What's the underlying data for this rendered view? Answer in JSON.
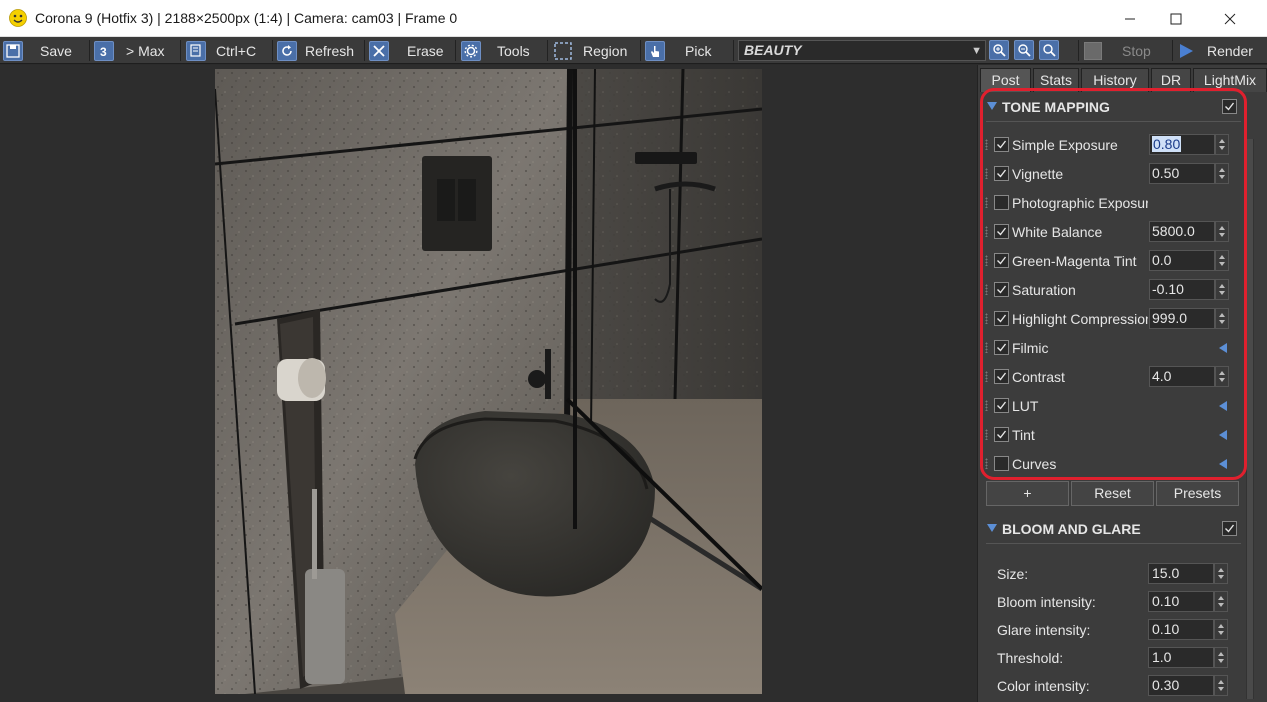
{
  "window": {
    "title": "Corona 9 (Hotfix 3) | 2188×2500px (1:4) | Camera: cam03 | Frame 0",
    "app_icon": "smiley-icon",
    "controls": [
      "minimize-icon",
      "maximize-icon",
      "close-icon"
    ]
  },
  "toolbar": {
    "save_label": "Save",
    "max_label": "> Max",
    "copy_label": "Ctrl+C",
    "refresh_label": "Refresh",
    "erase_label": "Erase",
    "tools_label": "Tools",
    "region_label": "Region",
    "pick_label": "Pick",
    "pass_selected": "BEAUTY",
    "stop_label": "Stop",
    "render_label": "Render"
  },
  "render": {
    "scene": "bathroom with wall-hung black toilet, grey stone wall, glass shower partition, toilet paper holder, brush holder"
  },
  "panel": {
    "tabs": [
      {
        "label": "Post",
        "active": true
      },
      {
        "label": "Stats",
        "active": false
      },
      {
        "label": "History",
        "active": false
      },
      {
        "label": "DR",
        "active": false
      },
      {
        "label": "LightMix",
        "active": false
      }
    ],
    "tone_mapping": {
      "title": "TONE MAPPING",
      "enabled": true,
      "rows": [
        {
          "label": "Simple Exposure",
          "checked": true,
          "value": "0.80",
          "kind": "spin",
          "selected": true
        },
        {
          "label": "Vignette",
          "checked": true,
          "value": "0.50",
          "kind": "spin"
        },
        {
          "label": "Photographic Exposure",
          "checked": false,
          "value": "",
          "kind": "none"
        },
        {
          "label": "White Balance",
          "checked": true,
          "value": "5800.0",
          "kind": "spin"
        },
        {
          "label": "Green-Magenta Tint",
          "checked": true,
          "value": "0.0",
          "kind": "spin"
        },
        {
          "label": "Saturation",
          "checked": true,
          "value": "-0.10",
          "kind": "spin"
        },
        {
          "label": "Highlight Compression",
          "checked": true,
          "value": "999.0",
          "kind": "spin"
        },
        {
          "label": "Filmic",
          "checked": true,
          "value": "",
          "kind": "expand"
        },
        {
          "label": "Contrast",
          "checked": true,
          "value": "4.0",
          "kind": "spin"
        },
        {
          "label": "LUT",
          "checked": true,
          "value": "",
          "kind": "expand"
        },
        {
          "label": "Tint",
          "checked": true,
          "value": "",
          "kind": "expand"
        },
        {
          "label": "Curves",
          "checked": false,
          "value": "",
          "kind": "expand"
        }
      ],
      "buttons": {
        "add": "+",
        "reset": "Reset",
        "presets": "Presets"
      }
    },
    "bloom_glare": {
      "title": "BLOOM AND GLARE",
      "enabled": true,
      "rows": [
        {
          "label": "Size:",
          "value": "15.0"
        },
        {
          "label": "Bloom intensity:",
          "value": "0.10"
        },
        {
          "label": "Glare intensity:",
          "value": "0.10"
        },
        {
          "label": "Threshold:",
          "value": "1.0"
        },
        {
          "label": "Color intensity:",
          "value": "0.30"
        }
      ]
    }
  },
  "colors": {
    "accent": "#5c8fd6",
    "highlight": "#e0202e"
  }
}
